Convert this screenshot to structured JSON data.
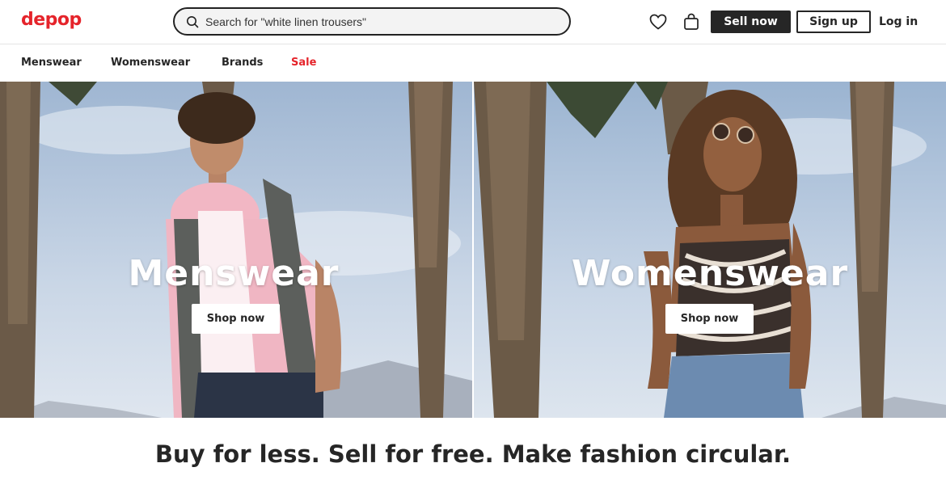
{
  "brand": {
    "logo_text": "depop",
    "accent_color": "#e5242b"
  },
  "search": {
    "placeholder": "Search for \"white linen trousers\"",
    "icon": "search-icon"
  },
  "header": {
    "icons": [
      "heart-icon",
      "bag-icon"
    ],
    "sell_label": "Sell now",
    "signup_label": "Sign up",
    "login_label": "Log in"
  },
  "nav": {
    "items": [
      {
        "label": "Menswear"
      },
      {
        "label": "Womenswear"
      },
      {
        "label": "Brands"
      },
      {
        "label": "Sale",
        "color": "#e5242b"
      }
    ]
  },
  "hero": {
    "panels": [
      {
        "title": "Menswear",
        "button": "Shop now"
      },
      {
        "title": "Womenswear",
        "button": "Shop now"
      }
    ]
  },
  "tagline": "Buy for less. Sell for free. Make fashion circular."
}
